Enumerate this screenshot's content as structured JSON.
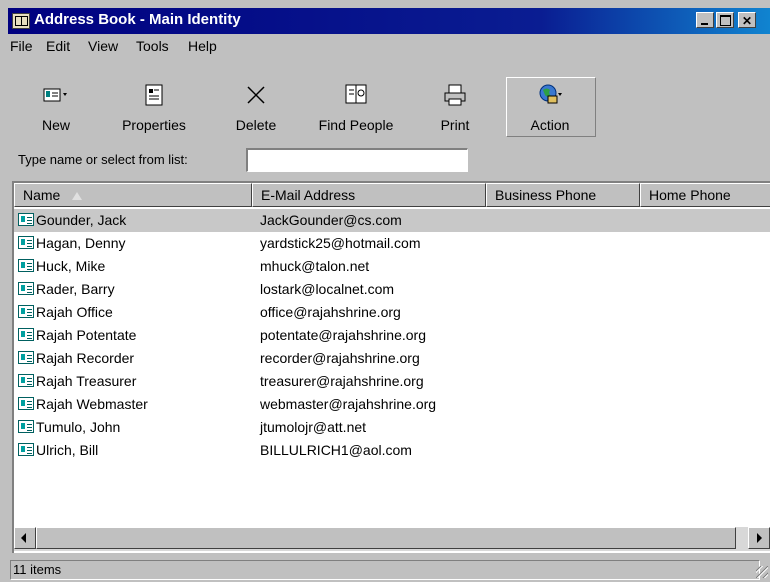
{
  "window": {
    "title": "Address Book - Main Identity"
  },
  "menu": [
    "File",
    "Edit",
    "View",
    "Tools",
    "Help"
  ],
  "toolbar": {
    "new": "New",
    "properties": "Properties",
    "delete": "Delete",
    "find_people": "Find People",
    "print": "Print",
    "action": "Action"
  },
  "search": {
    "label": "Type name or select from list:",
    "value": ""
  },
  "columns": {
    "name": "Name",
    "email": "E-Mail Address",
    "business_phone": "Business Phone",
    "home_phone": "Home Phone"
  },
  "contacts": [
    {
      "name": "Gounder, Jack",
      "email": "JackGounder@cs.com"
    },
    {
      "name": "Hagan, Denny",
      "email": "yardstick25@hotmail.com"
    },
    {
      "name": "Huck, Mike",
      "email": "mhuck@talon.net"
    },
    {
      "name": "Rader, Barry",
      "email": "lostark@localnet.com"
    },
    {
      "name": "Rajah Office",
      "email": "office@rajahshrine.org"
    },
    {
      "name": "Rajah Potentate",
      "email": "potentate@rajahshrine.org"
    },
    {
      "name": "Rajah Recorder",
      "email": "recorder@rajahshrine.org"
    },
    {
      "name": "Rajah Treasurer",
      "email": "treasurer@rajahshrine.org"
    },
    {
      "name": "Rajah Webmaster",
      "email": "webmaster@rajahshrine.org"
    },
    {
      "name": "Tumulo, John",
      "email": "jtumolojr@att.net"
    },
    {
      "name": "Ulrich, Bill",
      "email": "BILLULRICH1@aol.com"
    }
  ],
  "status": {
    "text": "11 items"
  },
  "colors": {
    "titlebar": "#000080",
    "face": "#c0c0c0",
    "selected_row": "#c8c8c8"
  }
}
